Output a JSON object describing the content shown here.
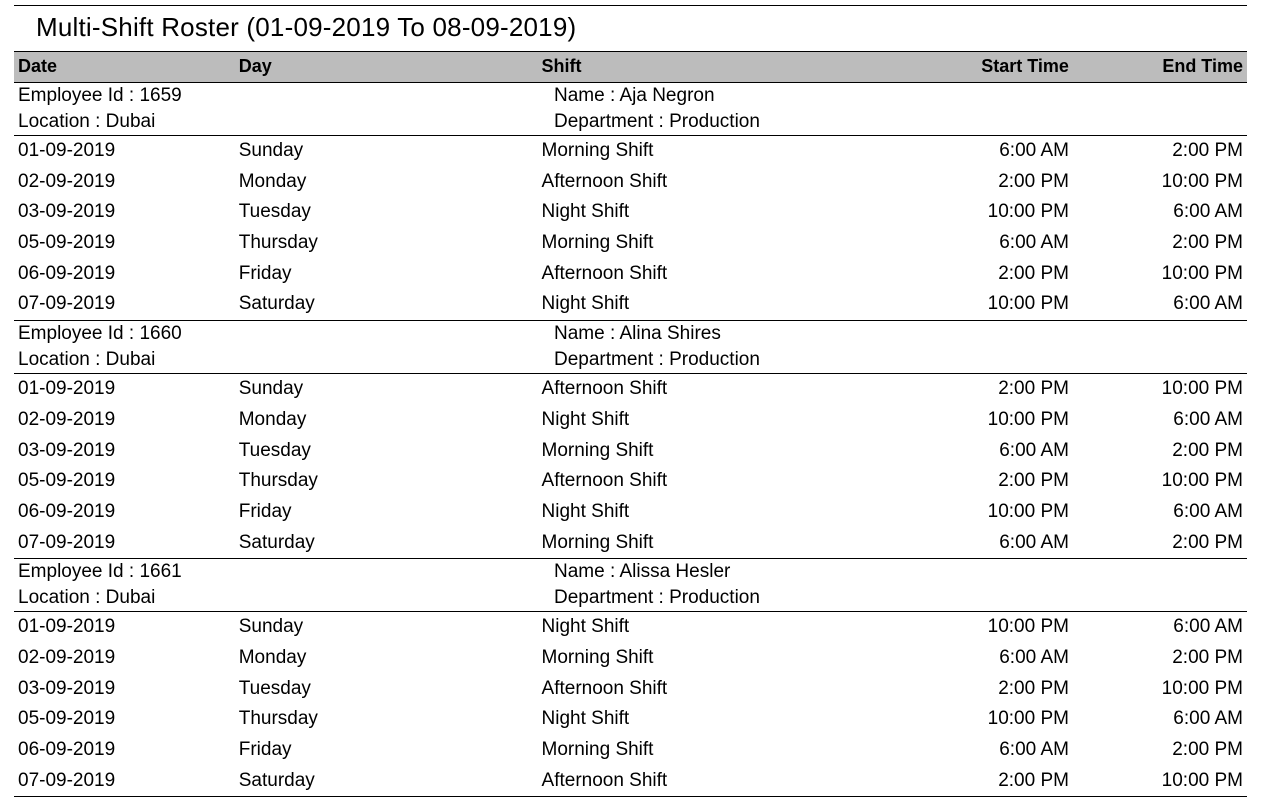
{
  "title": "Multi-Shift Roster (01-09-2019 To 08-09-2019)",
  "columns": {
    "date": "Date",
    "day": "Day",
    "shift": "Shift",
    "start": "Start Time",
    "end": "End Time"
  },
  "labels": {
    "employee_id": "Employee Id : ",
    "name": "Name : ",
    "location": "Location : ",
    "department": "Department : "
  },
  "employees": [
    {
      "id": "1659",
      "name": "Aja Negron",
      "location": "Dubai",
      "department": "Production",
      "shifts": [
        {
          "date": "01-09-2019",
          "day": "Sunday",
          "shift": "Morning Shift",
          "start": "6:00 AM",
          "end": "2:00 PM"
        },
        {
          "date": "02-09-2019",
          "day": "Monday",
          "shift": "Afternoon Shift",
          "start": "2:00 PM",
          "end": "10:00 PM"
        },
        {
          "date": "03-09-2019",
          "day": "Tuesday",
          "shift": "Night Shift",
          "start": "10:00 PM",
          "end": "6:00 AM"
        },
        {
          "date": "05-09-2019",
          "day": "Thursday",
          "shift": "Morning Shift",
          "start": "6:00 AM",
          "end": "2:00 PM"
        },
        {
          "date": "06-09-2019",
          "day": "Friday",
          "shift": "Afternoon Shift",
          "start": "2:00 PM",
          "end": "10:00 PM"
        },
        {
          "date": "07-09-2019",
          "day": "Saturday",
          "shift": "Night Shift",
          "start": "10:00 PM",
          "end": "6:00 AM"
        }
      ]
    },
    {
      "id": "1660",
      "name": "Alina Shires",
      "location": "Dubai",
      "department": "Production",
      "shifts": [
        {
          "date": "01-09-2019",
          "day": "Sunday",
          "shift": "Afternoon Shift",
          "start": "2:00 PM",
          "end": "10:00 PM"
        },
        {
          "date": "02-09-2019",
          "day": "Monday",
          "shift": "Night Shift",
          "start": "10:00 PM",
          "end": "6:00 AM"
        },
        {
          "date": "03-09-2019",
          "day": "Tuesday",
          "shift": "Morning Shift",
          "start": "6:00 AM",
          "end": "2:00 PM"
        },
        {
          "date": "05-09-2019",
          "day": "Thursday",
          "shift": "Afternoon Shift",
          "start": "2:00 PM",
          "end": "10:00 PM"
        },
        {
          "date": "06-09-2019",
          "day": "Friday",
          "shift": "Night Shift",
          "start": "10:00 PM",
          "end": "6:00 AM"
        },
        {
          "date": "07-09-2019",
          "day": "Saturday",
          "shift": "Morning Shift",
          "start": "6:00 AM",
          "end": "2:00 PM"
        }
      ]
    },
    {
      "id": "1661",
      "name": "Alissa Hesler",
      "location": "Dubai",
      "department": "Production",
      "shifts": [
        {
          "date": "01-09-2019",
          "day": "Sunday",
          "shift": "Night Shift",
          "start": "10:00 PM",
          "end": "6:00 AM"
        },
        {
          "date": "02-09-2019",
          "day": "Monday",
          "shift": "Morning Shift",
          "start": "6:00 AM",
          "end": "2:00 PM"
        },
        {
          "date": "03-09-2019",
          "day": "Tuesday",
          "shift": "Afternoon Shift",
          "start": "2:00 PM",
          "end": "10:00 PM"
        },
        {
          "date": "05-09-2019",
          "day": "Thursday",
          "shift": "Night Shift",
          "start": "10:00 PM",
          "end": "6:00 AM"
        },
        {
          "date": "06-09-2019",
          "day": "Friday",
          "shift": "Morning Shift",
          "start": "6:00 AM",
          "end": "2:00 PM"
        },
        {
          "date": "07-09-2019",
          "day": "Saturday",
          "shift": "Afternoon Shift",
          "start": "2:00 PM",
          "end": "10:00 PM"
        }
      ]
    }
  ]
}
